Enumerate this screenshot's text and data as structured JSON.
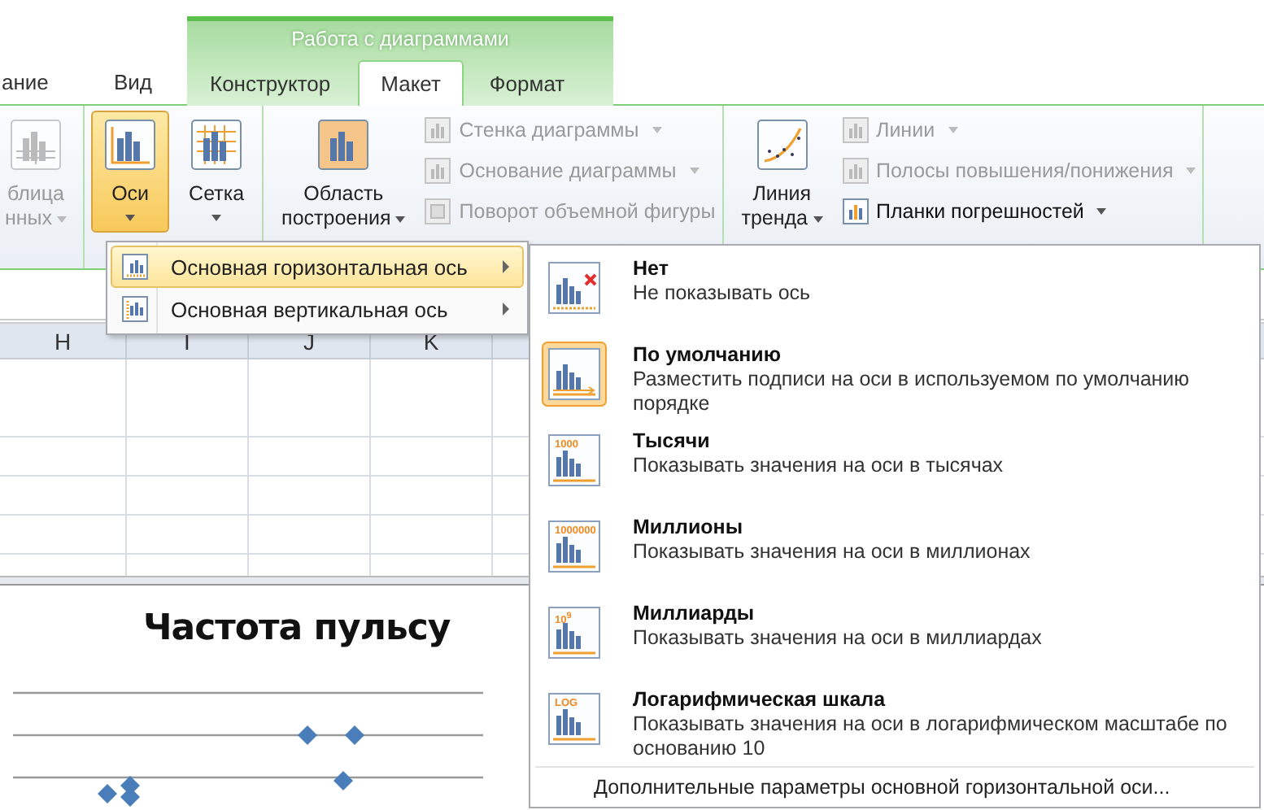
{
  "tabs": [
    {
      "label": "ание",
      "selected": false
    },
    {
      "label": "Вид",
      "selected": false
    }
  ],
  "context_group": {
    "title": "Работа с диаграммами",
    "tabs": [
      {
        "label": "Конструктор",
        "selected": false
      },
      {
        "label": "Макет",
        "selected": true
      },
      {
        "label": "Формат",
        "selected": false
      }
    ]
  },
  "ribbon": {
    "groups": [
      {
        "items": [
          {
            "kind": "large",
            "lines": [
              "блица",
              "нных"
            ],
            "dropdown": true,
            "disabled": true,
            "selected": false
          }
        ]
      },
      {
        "items": [
          {
            "kind": "large",
            "lines": [
              "Оси"
            ],
            "dropdown": true,
            "disabled": false,
            "selected": true
          },
          {
            "kind": "large",
            "lines": [
              "Сетка"
            ],
            "dropdown": true,
            "disabled": false,
            "selected": false
          }
        ]
      },
      {
        "items": [
          {
            "kind": "large",
            "lines": [
              "Область",
              "построения"
            ],
            "dropdown": true,
            "disabled": false,
            "selected": false
          },
          {
            "kind": "stack",
            "entries": [
              {
                "label": "Стенка диаграммы",
                "dropdown": true,
                "disabled": true
              },
              {
                "label": "Основание диаграммы",
                "dropdown": true,
                "disabled": true
              },
              {
                "label": "Поворот объемной фигуры",
                "dropdown": false,
                "disabled": true
              }
            ]
          }
        ]
      },
      {
        "items": [
          {
            "kind": "large",
            "lines": [
              "Линия",
              "тренда"
            ],
            "dropdown": true,
            "disabled": false,
            "selected": false
          },
          {
            "kind": "stack",
            "entries": [
              {
                "label": "Линии",
                "dropdown": true,
                "disabled": true
              },
              {
                "label": "Полосы повышения/понижения",
                "dropdown": true,
                "disabled": true
              },
              {
                "label": "Планки погрешностей",
                "dropdown": true,
                "disabled": false
              }
            ]
          }
        ]
      }
    ]
  },
  "sheet": {
    "columns": [
      "H",
      "I",
      "J",
      "K"
    ]
  },
  "chart": {
    "title": "Частота пульсу"
  },
  "axes_menu": {
    "items": [
      {
        "label": "Основная горизонтальная ось",
        "selected": true
      },
      {
        "label": "Основная вертикальная ось",
        "selected": false
      }
    ]
  },
  "axis_submenu": {
    "options": [
      {
        "kind": "none",
        "title": "Нет",
        "description": "Не показывать ось",
        "selected": false
      },
      {
        "kind": "default",
        "title": "По умолчанию",
        "description": "Разместить подписи на оси в используемом по умолчанию порядке",
        "selected": true
      },
      {
        "kind": "scale",
        "icon_text": "1000",
        "title": "Тысячи",
        "description": "Показывать значения на оси в тысячах",
        "selected": false
      },
      {
        "kind": "scale",
        "icon_text": "1000000",
        "title": "Миллионы",
        "description": "Показывать значения на оси в миллионах",
        "selected": false
      },
      {
        "kind": "scale",
        "icon_text": "10$^{9}$",
        "title": "Миллиарды",
        "description": "Показывать значения на оси в миллиардах",
        "selected": false
      },
      {
        "kind": "scale",
        "icon_text": "LOG",
        "title": "Логарифмическая шкала",
        "description": "Показывать значения на оси в логарифмическом масштабе по основанию 10",
        "selected": false
      }
    ],
    "footer": "Дополнительные параметры основной горизонтальной оси..."
  }
}
